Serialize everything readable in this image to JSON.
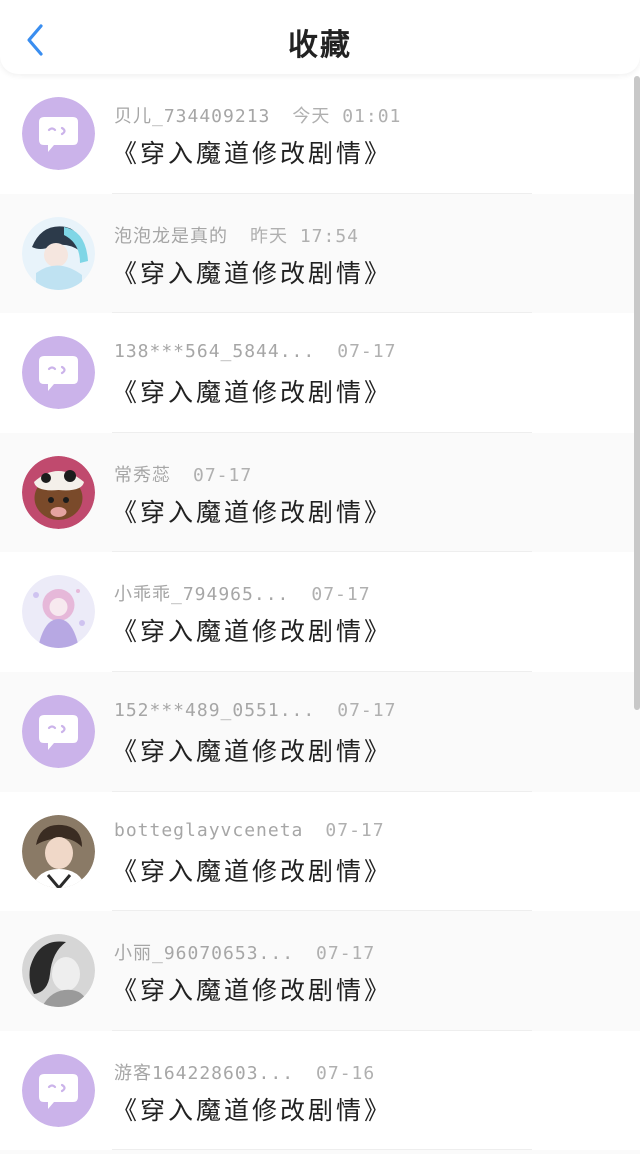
{
  "header": {
    "title": "收藏"
  },
  "colors": {
    "accent": "#3a8ef0",
    "avatar_placeholder": "#cbb3ea"
  },
  "favorites": [
    {
      "user": "贝儿_734409213",
      "time": "今天 01:01",
      "novel": "《穿入魔道修改剧情》",
      "avatar": "chat-bubble-icon"
    },
    {
      "user": "泡泡龙是真的",
      "time": "昨天 17:54",
      "novel": "《穿入魔道修改剧情》",
      "avatar": "user-photo"
    },
    {
      "user": "138***564_5844...",
      "time": "07-17",
      "novel": "《穿入魔道修改剧情》",
      "avatar": "chat-bubble-icon"
    },
    {
      "user": "常秀蕊",
      "time": "07-17",
      "novel": "《穿入魔道修改剧情》",
      "avatar": "user-photo"
    },
    {
      "user": "小乖乖_794965...",
      "time": "07-17",
      "novel": "《穿入魔道修改剧情》",
      "avatar": "user-photo"
    },
    {
      "user": "152***489_0551...",
      "time": "07-17",
      "novel": "《穿入魔道修改剧情》",
      "avatar": "chat-bubble-icon"
    },
    {
      "user": "botteglayvceneta",
      "time": "07-17",
      "novel": "《穿入魔道修改剧情》",
      "avatar": "user-photo"
    },
    {
      "user": "小丽_96070653...",
      "time": "07-17",
      "novel": "《穿入魔道修改剧情》",
      "avatar": "user-photo"
    },
    {
      "user": "游客164228603...",
      "time": "07-16",
      "novel": "《穿入魔道修改剧情》",
      "avatar": "chat-bubble-icon"
    }
  ]
}
